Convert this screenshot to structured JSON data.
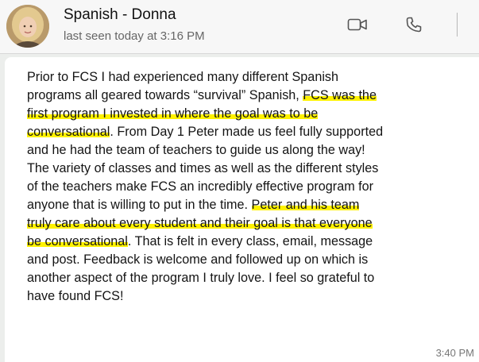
{
  "header": {
    "contact_name": "Spanish - Donna",
    "last_seen": "last seen today at 3:16 PM",
    "icons": {
      "video": "video-camera-icon",
      "call": "phone-icon"
    }
  },
  "message": {
    "lines": [
      {
        "parts": [
          {
            "text": "Prior to FCS I had experienced many different Spanish",
            "hl": false
          }
        ]
      },
      {
        "parts": [
          {
            "text": "programs all geared towards “survival” Spanish, ",
            "hl": false
          },
          {
            "text": "FCS was the",
            "hl": true
          }
        ]
      },
      {
        "parts": [
          {
            "text": "first program I invested in where the goal was to be",
            "hl": true
          }
        ]
      },
      {
        "parts": [
          {
            "text": "conversational",
            "hl": true
          },
          {
            "text": ". From Day 1 Peter made us feel fully supported",
            "hl": false
          }
        ]
      },
      {
        "parts": [
          {
            "text": "and he had the team of teachers to guide us along the way!",
            "hl": false
          }
        ]
      },
      {
        "parts": [
          {
            "text": "The variety of classes and times as well as the different styles",
            "hl": false
          }
        ]
      },
      {
        "parts": [
          {
            "text": "of the teachers make FCS an incredibly effective program for",
            "hl": false
          }
        ]
      },
      {
        "parts": [
          {
            "text": "anyone that is willing to put in the time. ",
            "hl": false
          },
          {
            "text": "Peter and his team",
            "hl": true
          }
        ]
      },
      {
        "parts": [
          {
            "text": "truly care about every student and their goal is that everyone",
            "hl": true
          }
        ]
      },
      {
        "parts": [
          {
            "text": "be conversational",
            "hl": true
          },
          {
            "text": ". That is felt in every class, email, message",
            "hl": false
          }
        ]
      },
      {
        "parts": [
          {
            "text": "and post. Feedback is welcome and followed up on which is",
            "hl": false
          }
        ]
      },
      {
        "parts": [
          {
            "text": "another aspect of the program I truly love. I feel so grateful to",
            "hl": false
          }
        ]
      },
      {
        "parts": [
          {
            "text": "have found FCS!",
            "hl": false
          }
        ]
      }
    ],
    "timestamp": "3:40 PM"
  },
  "colors": {
    "highlight": "#fff200",
    "header_bg": "#f7f7f7",
    "bubble_bg": "#ffffff"
  }
}
